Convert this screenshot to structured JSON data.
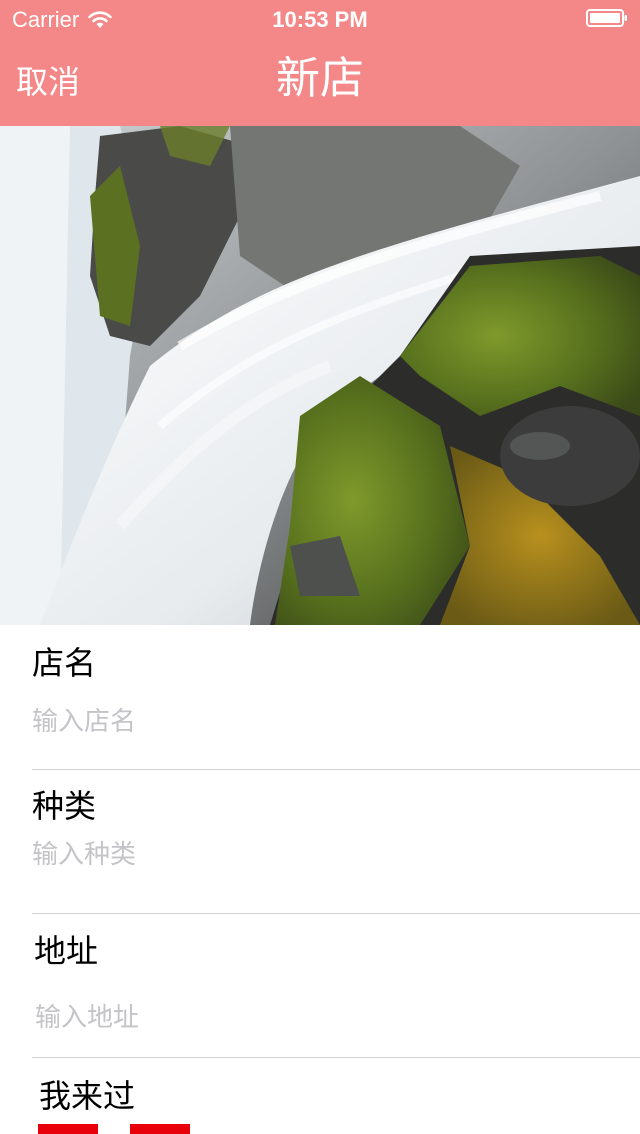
{
  "status_bar": {
    "carrier": "Carrier",
    "time": "10:53 PM",
    "icons": [
      "wifi-icon",
      "battery-icon"
    ]
  },
  "nav": {
    "cancel_label": "取消",
    "title": "新店"
  },
  "colors": {
    "nav_background": "#f48888",
    "nav_text": "#ffffff",
    "placeholder": "#c4c4c8",
    "separator": "#cfcfcf",
    "toggle_accent": "#e8000b"
  },
  "form": {
    "name": {
      "label": "店名",
      "placeholder": "输入店名",
      "value": ""
    },
    "type": {
      "label": "种类",
      "placeholder": "输入种类",
      "value": ""
    },
    "address": {
      "label": "地址",
      "placeholder": "输入地址",
      "value": ""
    },
    "been_here": {
      "label": "我来过"
    }
  }
}
